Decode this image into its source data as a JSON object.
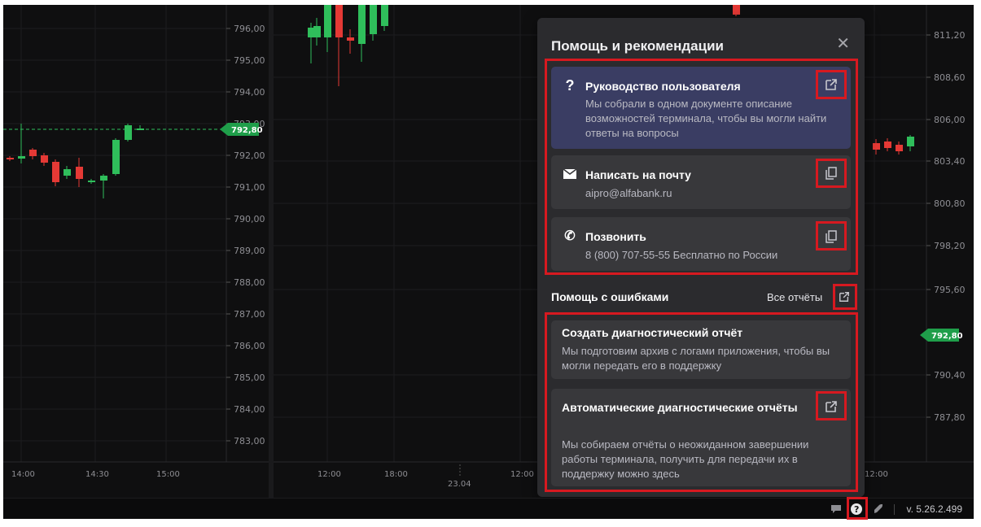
{
  "left_chart": {
    "price_labels": [
      "796,00",
      "795,00",
      "794,00",
      "793,00",
      "792,00",
      "791,00",
      "790,00",
      "789,00",
      "788,00",
      "787,00",
      "786,00",
      "785,00",
      "784,00",
      "783,00"
    ],
    "time_labels": [
      "14:00",
      "14:30",
      "15:00"
    ],
    "current_price": "792,80"
  },
  "right_chart": {
    "price_labels": [
      "811,20",
      "808,60",
      "806,00",
      "803,40",
      "800,80",
      "798,20",
      "795,60",
      "790,40",
      "787,80"
    ],
    "time_labels": [
      "12:00",
      "18:00",
      "12:00",
      "12:00"
    ],
    "date_label": "23.04",
    "current_price": "792,80"
  },
  "colors": {
    "up": "#2fbe5b",
    "down": "#e53935",
    "accent_red": "#d71920",
    "panel_bg": "#2b2b2e",
    "card_primary": "#3a3d63"
  },
  "help_panel": {
    "title": "Помощь и рекомендации",
    "close_icon": "close-icon",
    "guide": {
      "icon": "question-icon",
      "title": "Руководство пользователя",
      "description": "Мы собрали в одном документе описание возможностей терминала, чтобы вы могли найти ответы на вопросы",
      "action_icon": "external-link-icon"
    },
    "email": {
      "icon": "envelope-icon",
      "title": "Написать на почту",
      "address": "aipro@alfabank.ru",
      "action_icon": "copy-icon"
    },
    "phone": {
      "icon": "phone-icon",
      "title": "Позвонить",
      "number": "8 (800) 707-55-55 Бесплатно по России",
      "action_icon": "copy-icon"
    },
    "errors_section": {
      "title": "Помощь с ошибками",
      "all_reports": "Все отчёты",
      "action_icon": "external-link-icon"
    },
    "create_report": {
      "title": "Создать диагностический отчёт",
      "description": "Мы подготовим архив с логами приложения, чтобы вы могли передать его в поддержку"
    },
    "auto_reports": {
      "title": "Автоматические диагностические отчёты",
      "description": "Мы собираем отчёты о неожиданном завершении работы терминала, получить для передачи их в поддержку можно здесь",
      "action_icon": "external-link-icon"
    }
  },
  "status_bar": {
    "icons": [
      "chat-icon",
      "help-icon",
      "rocket-icon"
    ],
    "version": "v. 5.26.2.499"
  }
}
